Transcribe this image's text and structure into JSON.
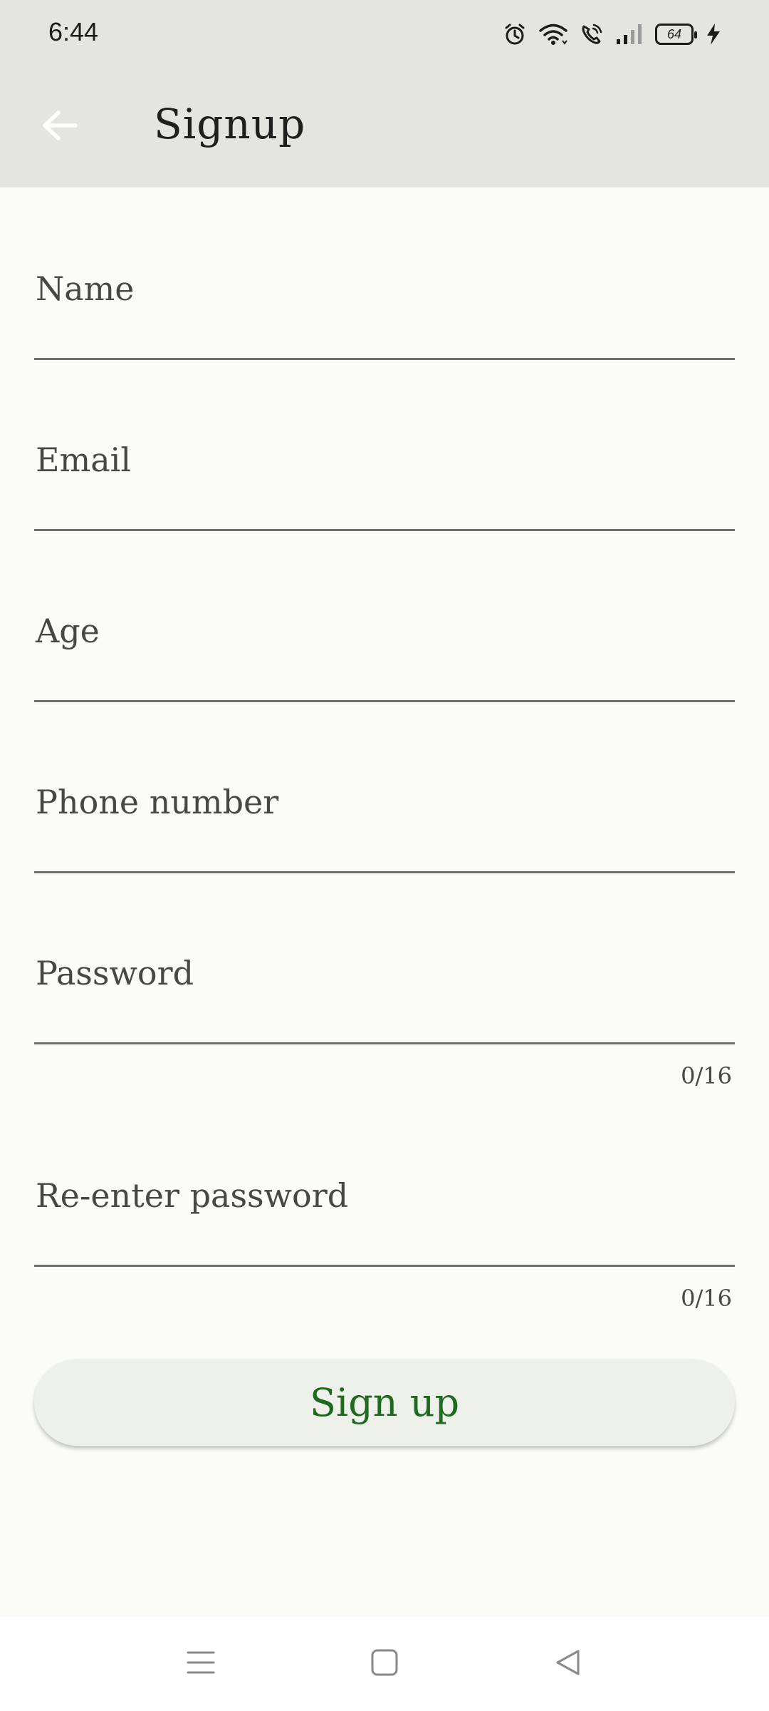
{
  "status_bar": {
    "time": "6:44",
    "battery_level": "64",
    "icons": [
      "alarm-icon",
      "wifi-icon",
      "wifi-calling-icon",
      "signal-icon",
      "battery-icon",
      "charging-icon"
    ]
  },
  "app_bar": {
    "back_icon": "arrow-left-icon",
    "title": "Signup"
  },
  "form": {
    "fields": [
      {
        "label": "Name",
        "value": ""
      },
      {
        "label": "Email",
        "value": ""
      },
      {
        "label": "Age",
        "value": ""
      },
      {
        "label": "Phone number",
        "value": ""
      },
      {
        "label": "Password",
        "value": "",
        "counter": "0/16"
      },
      {
        "label": "Re-enter password",
        "value": "",
        "counter": "0/16"
      }
    ],
    "submit_label": "Sign up"
  },
  "nav_bar": {
    "icons": [
      "menu-icon",
      "home-icon",
      "back-icon"
    ]
  },
  "colors": {
    "background": "#fbfcf7",
    "app_bar": "#e4e5e0",
    "button_bg": "#edf1ea",
    "button_text": "#1f6a1f",
    "underline": "#6e706b"
  }
}
